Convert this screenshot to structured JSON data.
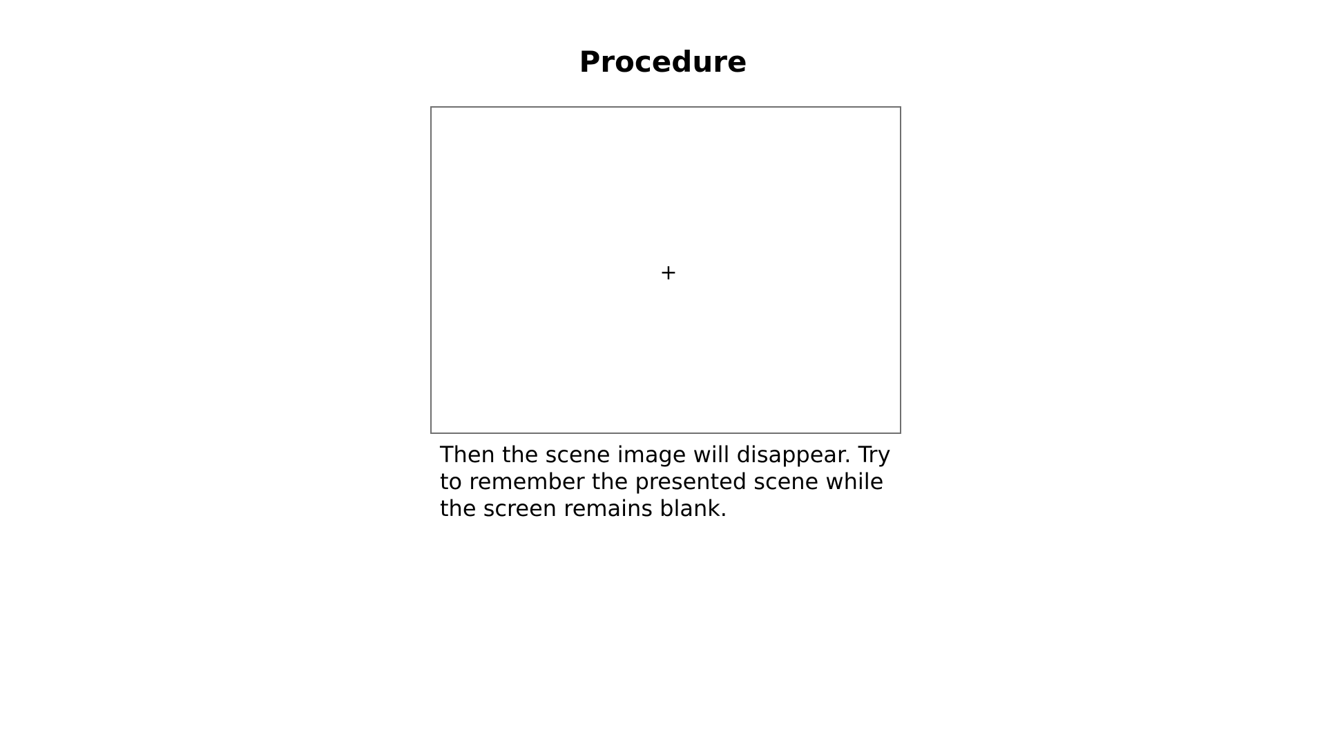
{
  "slide": {
    "title": "Procedure",
    "fixation": {
      "glyph": "+",
      "icon": "fixation-cross-icon"
    },
    "instruction": "Then the scene image will disappear. Try to remember the presented scene while the screen remains blank."
  },
  "colors": {
    "background": "#ffffff",
    "text": "#000000",
    "frame_border": "#6f6f6f"
  }
}
